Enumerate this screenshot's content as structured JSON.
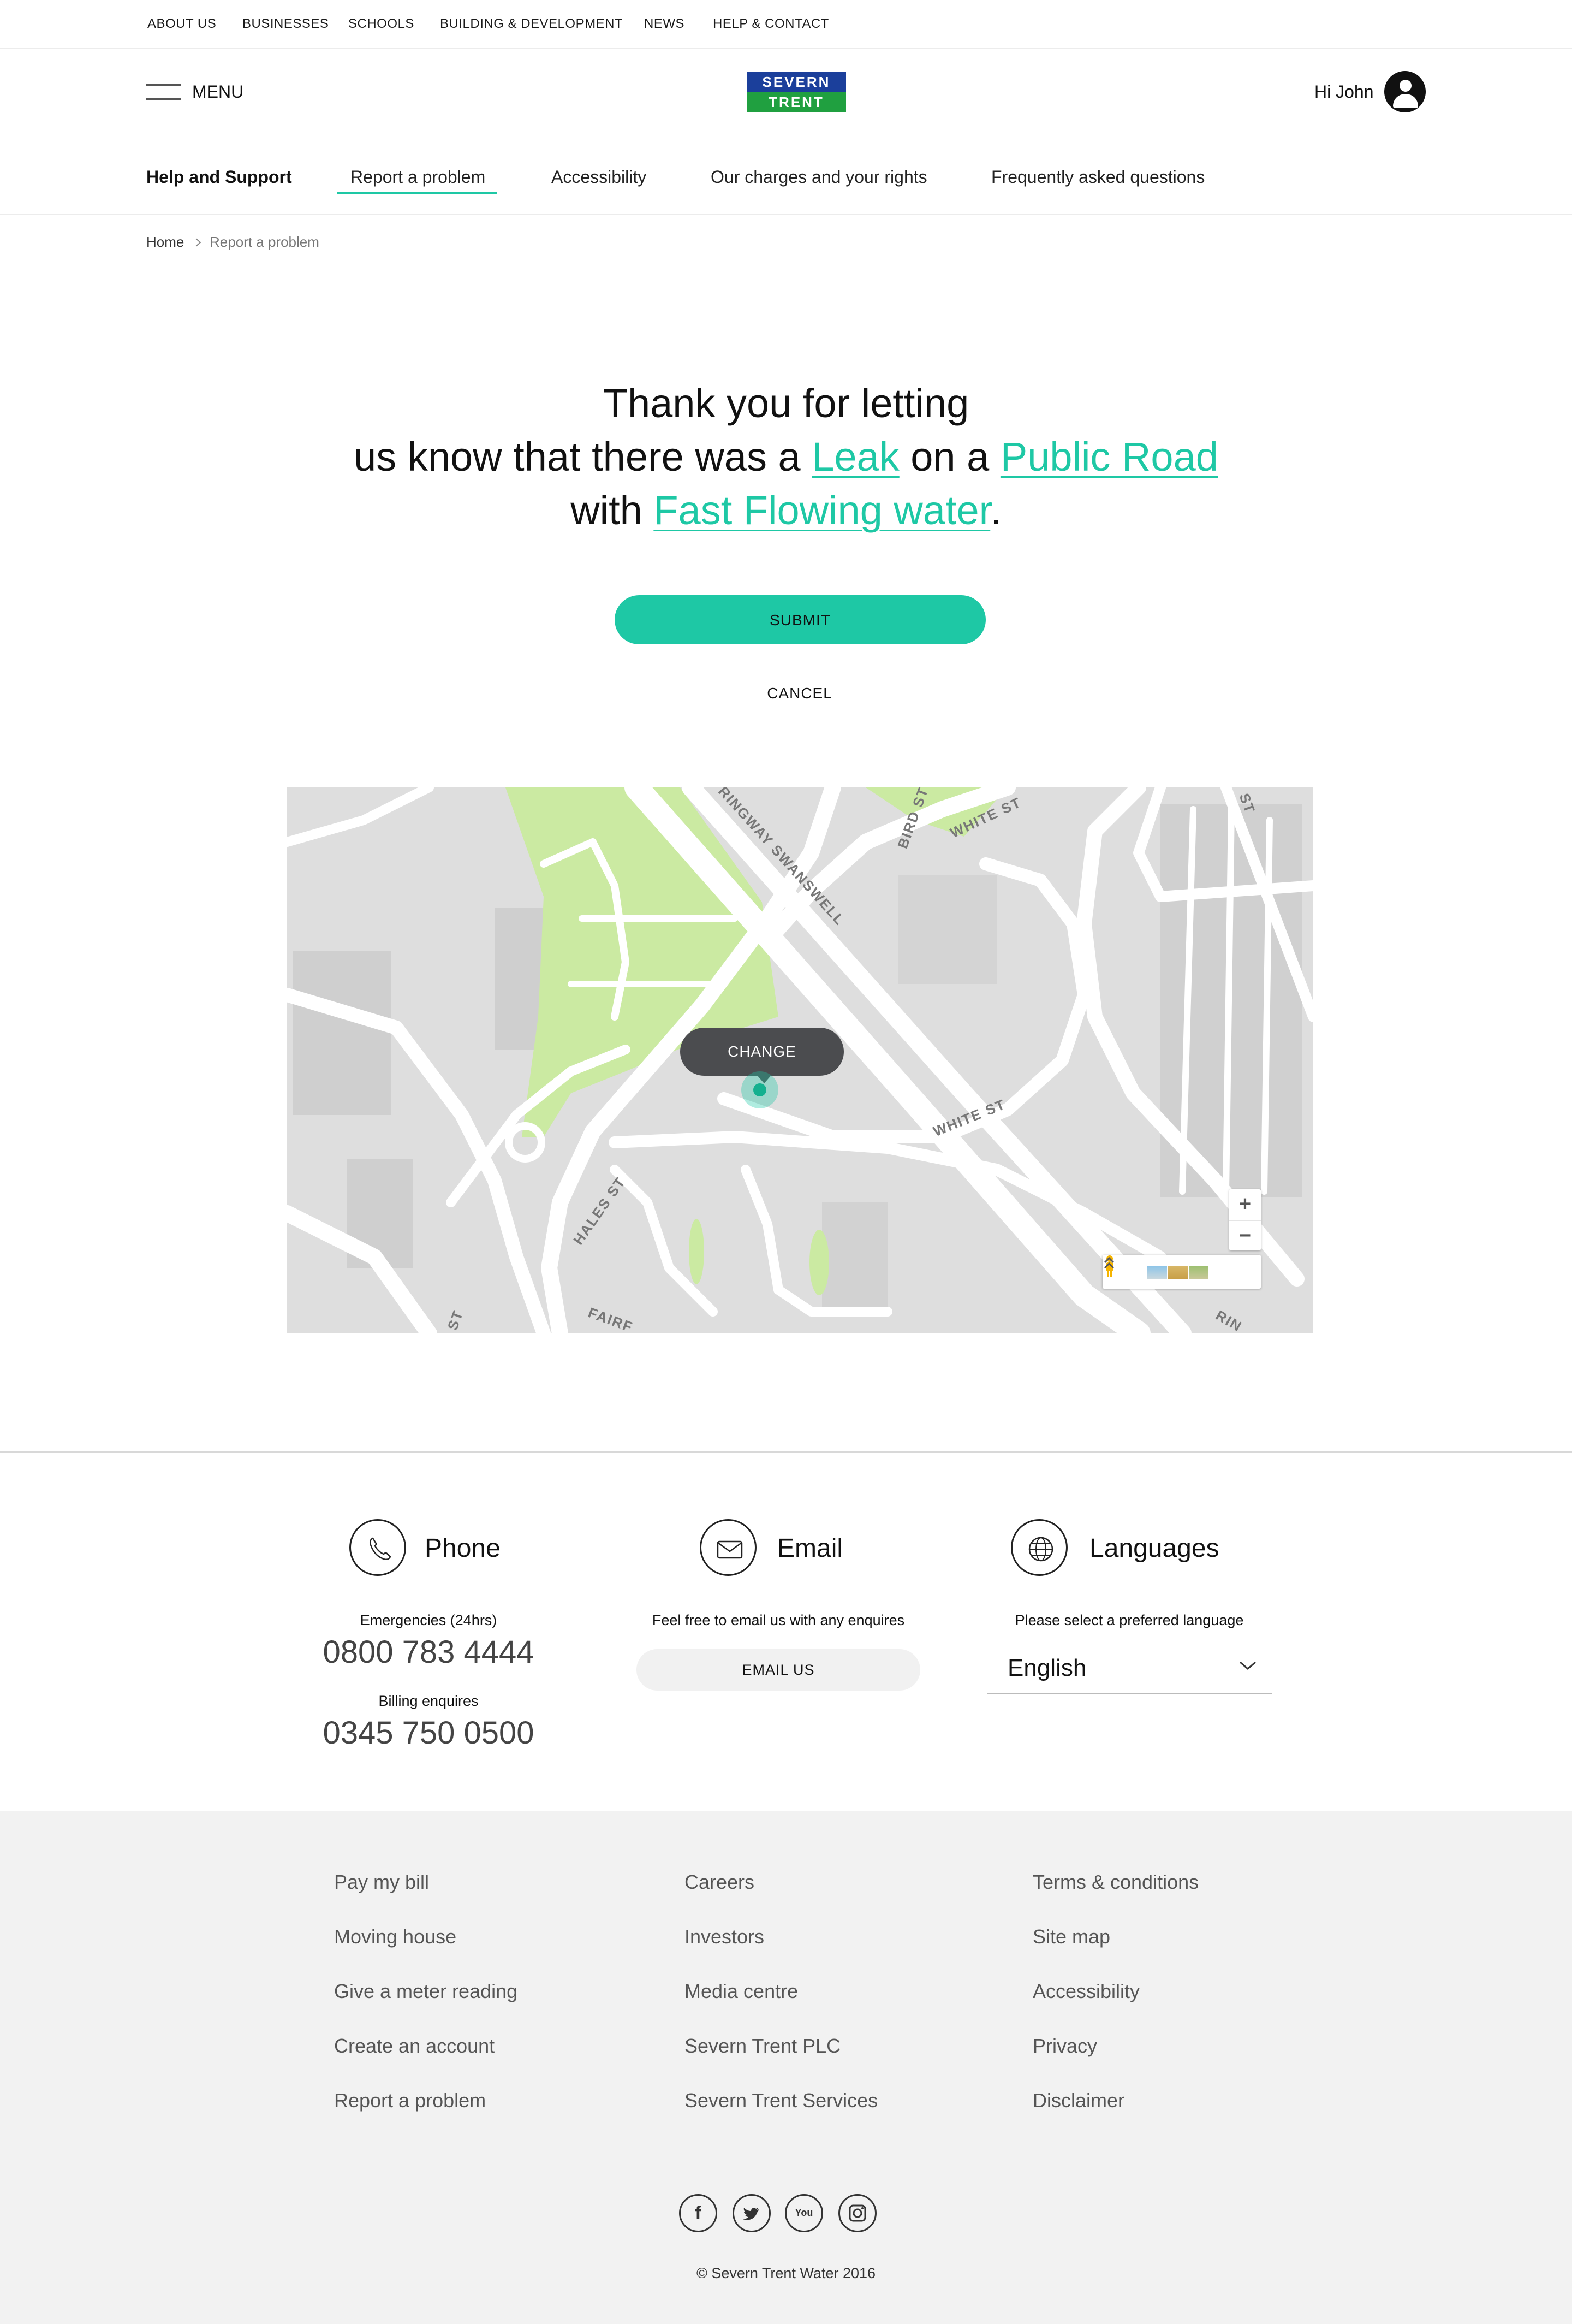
{
  "util_nav": [
    "ABOUT US",
    "BUSINESSES",
    "SCHOOLS",
    "BUILDING & DEVELOPMENT",
    "NEWS",
    "HELP & CONTACT"
  ],
  "header": {
    "menu_label": "MENU",
    "logo_top": "SEVERN",
    "logo_bottom": "TRENT",
    "greeting": "Hi John",
    "brand_colors": {
      "blue": "#1b3f9b",
      "green": "#20a040",
      "accent": "#1ec8a5"
    }
  },
  "subnav": {
    "section_title": "Help and Support",
    "items": [
      "Report a problem",
      "Accessibility",
      "Our charges and your rights",
      "Frequently asked questions"
    ],
    "active": "Report a problem"
  },
  "breadcrumb": {
    "home": "Home",
    "current": "Report a problem"
  },
  "confirmation": {
    "line1": "Thank you for letting",
    "line2_pre": "us know that there was a ",
    "problem": "Leak",
    "line2_mid": " on a ",
    "location": "Public Road",
    "line3_pre": "with ",
    "detail": "Fast Flowing water",
    "line3_post": ".",
    "submit_label": "SUBMIT",
    "cancel_label": "CANCEL"
  },
  "map": {
    "change_label": "CHANGE",
    "zoom_in": "+",
    "zoom_out": "−",
    "roads": [
      "RINGWAY SWANSWELL",
      "WHITE ST",
      "WHITE ST",
      "BIRD ST",
      "HALES ST",
      "FAIRF",
      "ST",
      "RIN",
      "ST"
    ]
  },
  "contact": {
    "phone": {
      "title": "Phone",
      "emergency_label": "Emergencies (24hrs)",
      "emergency_number": "0800 783 4444",
      "billing_label": "Billing enquires",
      "billing_number": "0345 750 0500"
    },
    "email": {
      "title": "Email",
      "text": "Feel free to email us with any enquires",
      "button": "EMAIL US"
    },
    "languages": {
      "title": "Languages",
      "text": "Please select a preferred language",
      "selected": "English"
    }
  },
  "footer": {
    "col1": [
      "Pay my bill",
      "Moving house",
      "Give a meter reading",
      "Create an account",
      "Report a problem"
    ],
    "col2": [
      "Careers",
      "Investors",
      "Media centre",
      "Severn Trent PLC",
      "Severn Trent Services"
    ],
    "col3": [
      "Terms & conditions",
      "Site map",
      "Accessibility",
      "Privacy",
      "Disclaimer"
    ],
    "social": [
      "facebook-icon",
      "twitter-icon",
      "youtube-icon",
      "instagram-icon"
    ],
    "copyright": "© Severn Trent Water 2016"
  }
}
